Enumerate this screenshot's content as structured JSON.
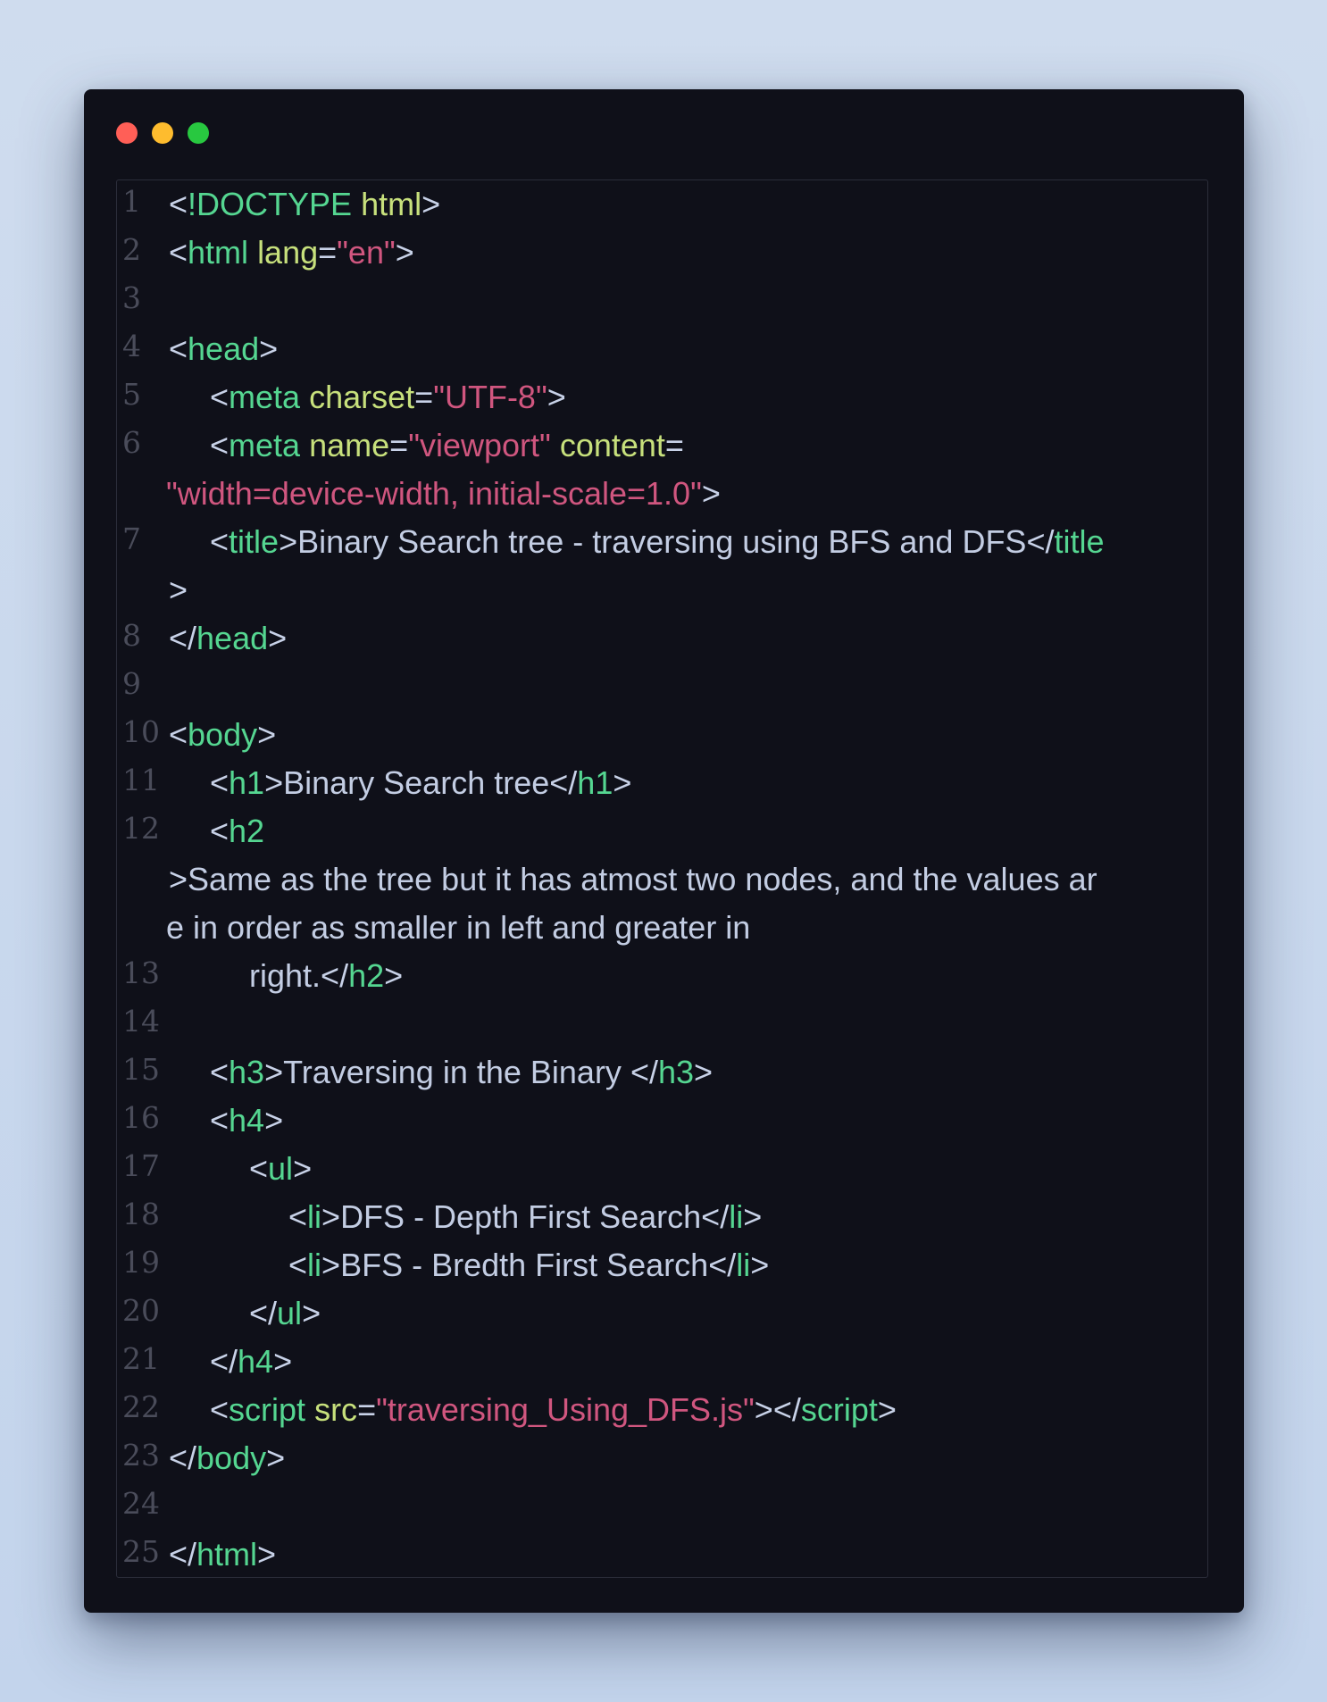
{
  "window": {
    "buttons": {
      "close_color": "#ff5f57",
      "minimize_color": "#febc2e",
      "maximize_color": "#28c840"
    }
  },
  "colors": {
    "background": "#0f1019",
    "punctuation": "#c8d2e8",
    "tag": "#55d691",
    "attribute": "#c7e07c",
    "string": "#d0567f",
    "text": "#c3cde3",
    "line_number": "#4a4c5a"
  },
  "editor": {
    "line_numbers": [
      "1",
      "2",
      "3",
      "4",
      "5",
      "6",
      "7",
      "8",
      "9",
      "10",
      "11",
      "12",
      "13",
      "14",
      "15",
      "16",
      "17",
      "18",
      "19",
      "20",
      "21",
      "22",
      "23",
      "24",
      "25"
    ],
    "tokens": {
      "l1": {
        "lt": "<",
        "doctype": "!DOCTYPE",
        "html": "html",
        "gt": ">"
      },
      "l2": {
        "lt": "<",
        "tag": "html",
        "attr": "lang",
        "eq": "=",
        "val": "\"en\"",
        "gt": ">"
      },
      "l4": {
        "lt": "<",
        "tag": "head",
        "gt": ">"
      },
      "l5": {
        "lt": "<",
        "tag": "meta",
        "attr": "charset",
        "eq": "=",
        "val": "\"UTF-8\"",
        "gt": ">"
      },
      "l6": {
        "lt": "<",
        "tag": "meta",
        "attr1": "name",
        "eq1": "=",
        "val1": "\"viewport\"",
        "attr2": "content",
        "eq2": "=",
        "val2": "\"width=device-width, initial-scale=1.0\"",
        "gt": ">"
      },
      "l7": {
        "lt": "<",
        "tag": "title",
        "gt": ">",
        "text": "Binary Search tree - traversing using BFS and DFS",
        "close_lt": "</",
        "close_tag": "title",
        "close_gt": ">"
      },
      "l8": {
        "lt": "</",
        "tag": "head",
        "gt": ">"
      },
      "l10": {
        "lt": "<",
        "tag": "body",
        "gt": ">"
      },
      "l11": {
        "lt": "<",
        "tag": "h1",
        "gt": ">",
        "text": "Binary Search tree",
        "close_lt": "</",
        "close_tag": "h1",
        "close_gt": ">"
      },
      "l12": {
        "lt": "<",
        "tag": "h2",
        "gt": ">",
        "text_a": "Same as the tree but it has atmost two nodes, and the values ar",
        "text_b": "e in order as smaller in left and greater in"
      },
      "l13": {
        "text": "right.",
        "close_lt": "</",
        "close_tag": "h2",
        "close_gt": ">"
      },
      "l15": {
        "lt": "<",
        "tag": "h3",
        "gt": ">",
        "text": "Traversing in the Binary ",
        "close_lt": "</",
        "close_tag": "h3",
        "close_gt": ">"
      },
      "l16": {
        "lt": "<",
        "tag": "h4",
        "gt": ">"
      },
      "l17": {
        "lt": "<",
        "tag": "ul",
        "gt": ">"
      },
      "l18": {
        "lt": "<",
        "tag": "li",
        "gt": ">",
        "text": "DFS - Depth First Search",
        "close_lt": "</",
        "close_tag": "li",
        "close_gt": ">"
      },
      "l19": {
        "lt": "<",
        "tag": "li",
        "gt": ">",
        "text": "BFS - Bredth First Search",
        "close_lt": "</",
        "close_tag": "li",
        "close_gt": ">"
      },
      "l20": {
        "lt": "</",
        "tag": "ul",
        "gt": ">"
      },
      "l21": {
        "lt": "</",
        "tag": "h4",
        "gt": ">"
      },
      "l22": {
        "lt": "<",
        "tag": "script",
        "attr": "src",
        "eq": "=",
        "val": "\"traversing_Using_DFS.js\"",
        "gt": ">",
        "close_lt": "</",
        "close_tag": "script",
        "close_gt": ">"
      },
      "l23": {
        "lt": "</",
        "tag": "body",
        "gt": ">"
      },
      "l25": {
        "lt": "</",
        "tag": "html",
        "gt": ">"
      }
    }
  }
}
